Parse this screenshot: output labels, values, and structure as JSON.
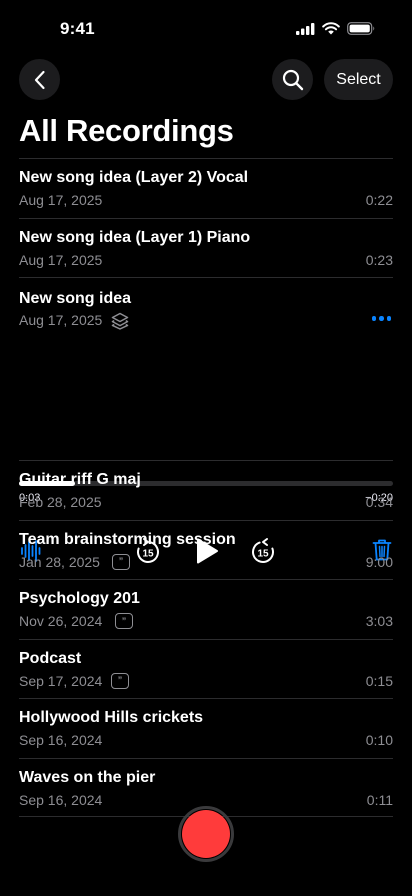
{
  "status": {
    "time": "9:41"
  },
  "nav": {
    "select_label": "Select"
  },
  "page": {
    "title": "All Recordings"
  },
  "recordings_top": [
    {
      "title": "New song idea  (Layer 2) Vocal",
      "date": "Aug 17, 2025",
      "duration": "0:22"
    },
    {
      "title": "New song idea  (Layer 1) Piano",
      "date": "Aug 17, 2025",
      "duration": "0:23"
    }
  ],
  "expanded": {
    "title": "New song idea",
    "date": "Aug 17, 2025",
    "progress": 0.15,
    "elapsed": "0:03",
    "remaining": "−0:20",
    "skip_seconds": "15"
  },
  "recordings_bottom": [
    {
      "title": "Guitar riff G maj",
      "date": "Feb 28, 2025",
      "duration": "0:34",
      "transcript": false
    },
    {
      "title": "Team brainstorming session",
      "date": "Jan 28, 2025",
      "duration": "9:00",
      "transcript": true
    },
    {
      "title": "Psychology 201",
      "date": "Nov 26, 2024",
      "duration": "3:03",
      "transcript": true
    },
    {
      "title": "Podcast",
      "date": "Sep 17, 2024",
      "duration": "0:15",
      "transcript": true
    },
    {
      "title": "Hollywood Hills crickets",
      "date": "Sep 16, 2024",
      "duration": "0:10",
      "transcript": false
    },
    {
      "title": "Waves on the pier",
      "date": "Sep 16, 2024",
      "duration": "0:11",
      "transcript": false
    }
  ],
  "colors": {
    "accent": "#0a84ff",
    "record": "#ff3b3b",
    "secondary_text": "#8e8e93"
  },
  "icons": [
    "back-chevron-icon",
    "search-icon",
    "layers-icon",
    "more-icon",
    "waveform-icon",
    "skip-back-15-icon",
    "play-icon",
    "skip-forward-15-icon",
    "trash-icon",
    "transcript-icon",
    "record-icon"
  ]
}
